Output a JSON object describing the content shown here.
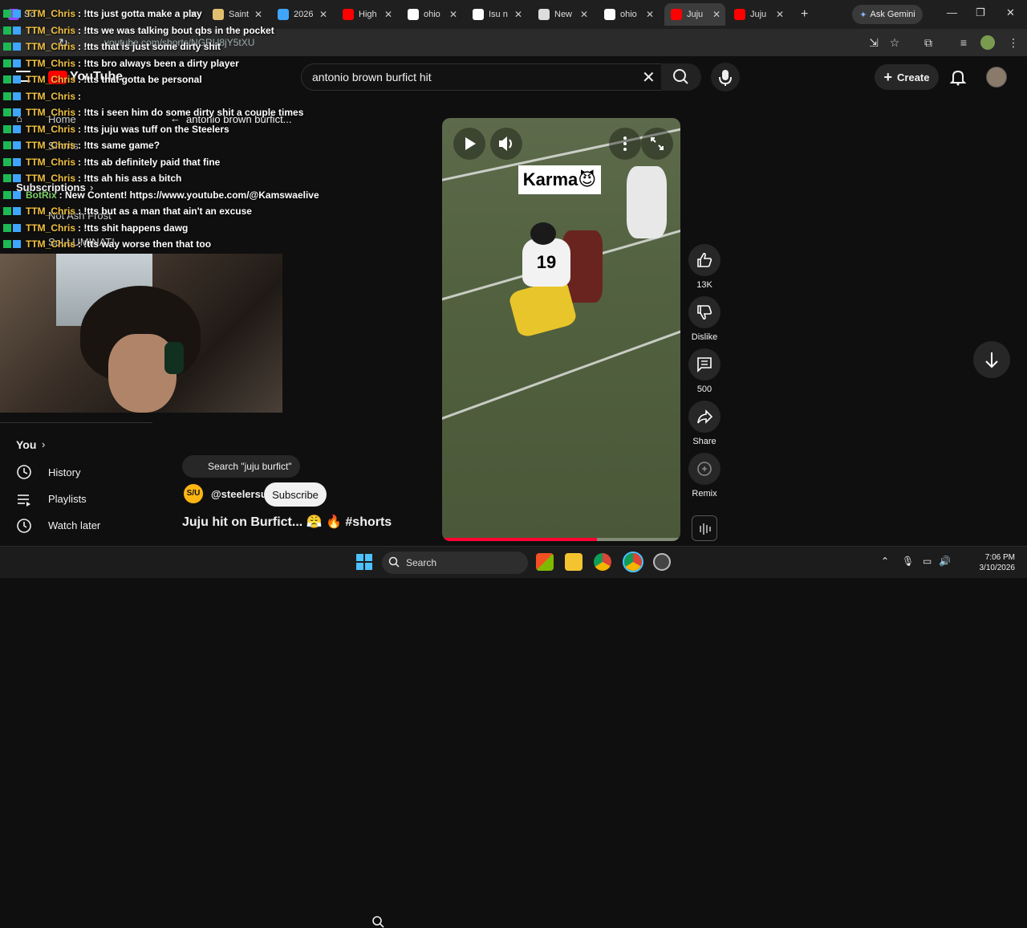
{
  "browser": {
    "tabs": [
      {
        "label": "Sc",
        "icon": "twitch-icon",
        "color": "#9146ff"
      },
      {
        "label": "Saint",
        "icon": "site-icon",
        "color": "#e0c070"
      },
      {
        "label": "2026",
        "icon": "site-icon",
        "color": "#3ea6ff"
      },
      {
        "label": "High",
        "icon": "youtube-icon",
        "color": "#ff0000"
      },
      {
        "label": "ohio",
        "icon": "google-icon",
        "color": "#ffffff"
      },
      {
        "label": "Isu n",
        "icon": "google-icon",
        "color": "#ffffff"
      },
      {
        "label": "New",
        "icon": "chrome-icon",
        "color": "#dddddd"
      },
      {
        "label": "ohio",
        "icon": "google-icon",
        "color": "#ffffff"
      },
      {
        "label": "Juju",
        "icon": "youtube-icon",
        "color": "#ff0000",
        "active": true
      },
      {
        "label": "Juju",
        "icon": "youtube-icon",
        "color": "#ff0000"
      }
    ],
    "new_tab": "+",
    "gemini_label": "Ask Gemini",
    "url": "youtube.com/shorts/NGRU8jY5tXU"
  },
  "youtube": {
    "logo_text": "YouTube",
    "search_query": "antonio brown burfict hit",
    "create_label": "Create",
    "back_query": "antonio brown burfict..."
  },
  "chat": [
    {
      "user": "TTM_Chris",
      "msg": ": !tts just gotta make a play"
    },
    {
      "user": "TTM_Chris",
      "msg": ": !tts we was talking bout qbs in the pocket"
    },
    {
      "user": "TTM_Chris",
      "msg": ": !tts that is just some dirty shit"
    },
    {
      "user": "TTM_Chris",
      "msg": ": !tts bro always been a dirty player"
    },
    {
      "user": "TTM_Chris",
      "msg": ": !tts that gotta be personal"
    },
    {
      "user": "TTM_Chris",
      "msg": ":"
    },
    {
      "user": "TTM_Chris",
      "msg": ": !tts i seen him do some dirty shit a couple times"
    },
    {
      "user": "TTM_Chris",
      "msg": ": !tts juju was tuff on the Steelers"
    },
    {
      "user": "TTM_Chris",
      "msg": ": !tts same game?"
    },
    {
      "user": "TTM_Chris",
      "msg": ": !tts ab definitely paid that fine"
    },
    {
      "user": "TTM_Chris",
      "msg": ": !tts ah his ass a bitch"
    },
    {
      "user": "BotRix",
      "msg": ": New Content! https://www.youtube.com/@Kamswaelive",
      "bot": true
    },
    {
      "user": "TTM_Chris",
      "msg": ": !tts but as a man that ain't an excuse"
    },
    {
      "user": "TTM_Chris",
      "msg": ": !tts shit happens dawg"
    },
    {
      "user": "TTM_Chris",
      "msg": ": !tts way worse then that too"
    }
  ],
  "sidebar": {
    "home": "Home",
    "shorts": "Shorts",
    "subscriptions": "Subscriptions",
    "sub_items": [
      "Not Ash Frost",
      "SoLLUMINATI"
    ],
    "you": "You",
    "items": [
      "History",
      "Playlists",
      "Watch later"
    ]
  },
  "short": {
    "search_chip": "Search \"juju burfict\"",
    "channel_avatar": "S/U",
    "channel": "@steelersu",
    "subscribe": "Subscribe",
    "title": "Juju hit on Burfict... 😤 🔥 #shorts",
    "overlay_text": "Karma😈",
    "jersey_number": "19",
    "progress": 0.65
  },
  "actions": {
    "likes": "13K",
    "dislike": "Dislike",
    "comments": "500",
    "share": "Share",
    "remix": "Remix"
  },
  "taskbar": {
    "search": "Search",
    "time": "7:06 PM",
    "date": "3/10/2026"
  }
}
